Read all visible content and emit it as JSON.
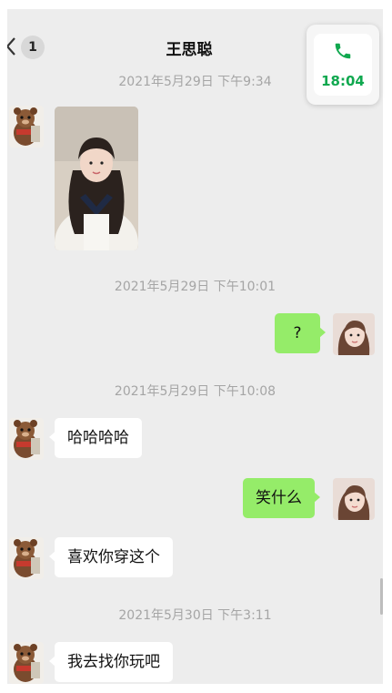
{
  "header": {
    "unread_count": "1",
    "contact_name": "王思聪"
  },
  "call_float": {
    "time": "18:04"
  },
  "timestamps": [
    "2021年5月29日 下午9:34",
    "2021年5月29日 下午10:01",
    "2021年5月29日 下午10:08",
    "2021年5月30日 下午3:11"
  ],
  "messages": [
    {
      "side": "in",
      "text": "哈哈哈哈"
    },
    {
      "side": "out",
      "text": "?"
    },
    {
      "side": "out",
      "text": "笑什么"
    },
    {
      "side": "in",
      "text": "喜欢你穿这个"
    },
    {
      "side": "in",
      "text": "我去找你玩吧"
    }
  ],
  "colors": {
    "chat_background": "#ededed",
    "incoming_bubble": "#ffffff",
    "outgoing_bubble": "#95ec69",
    "call_accent": "#10a84f",
    "timestamp_text": "#a5a5a5"
  }
}
